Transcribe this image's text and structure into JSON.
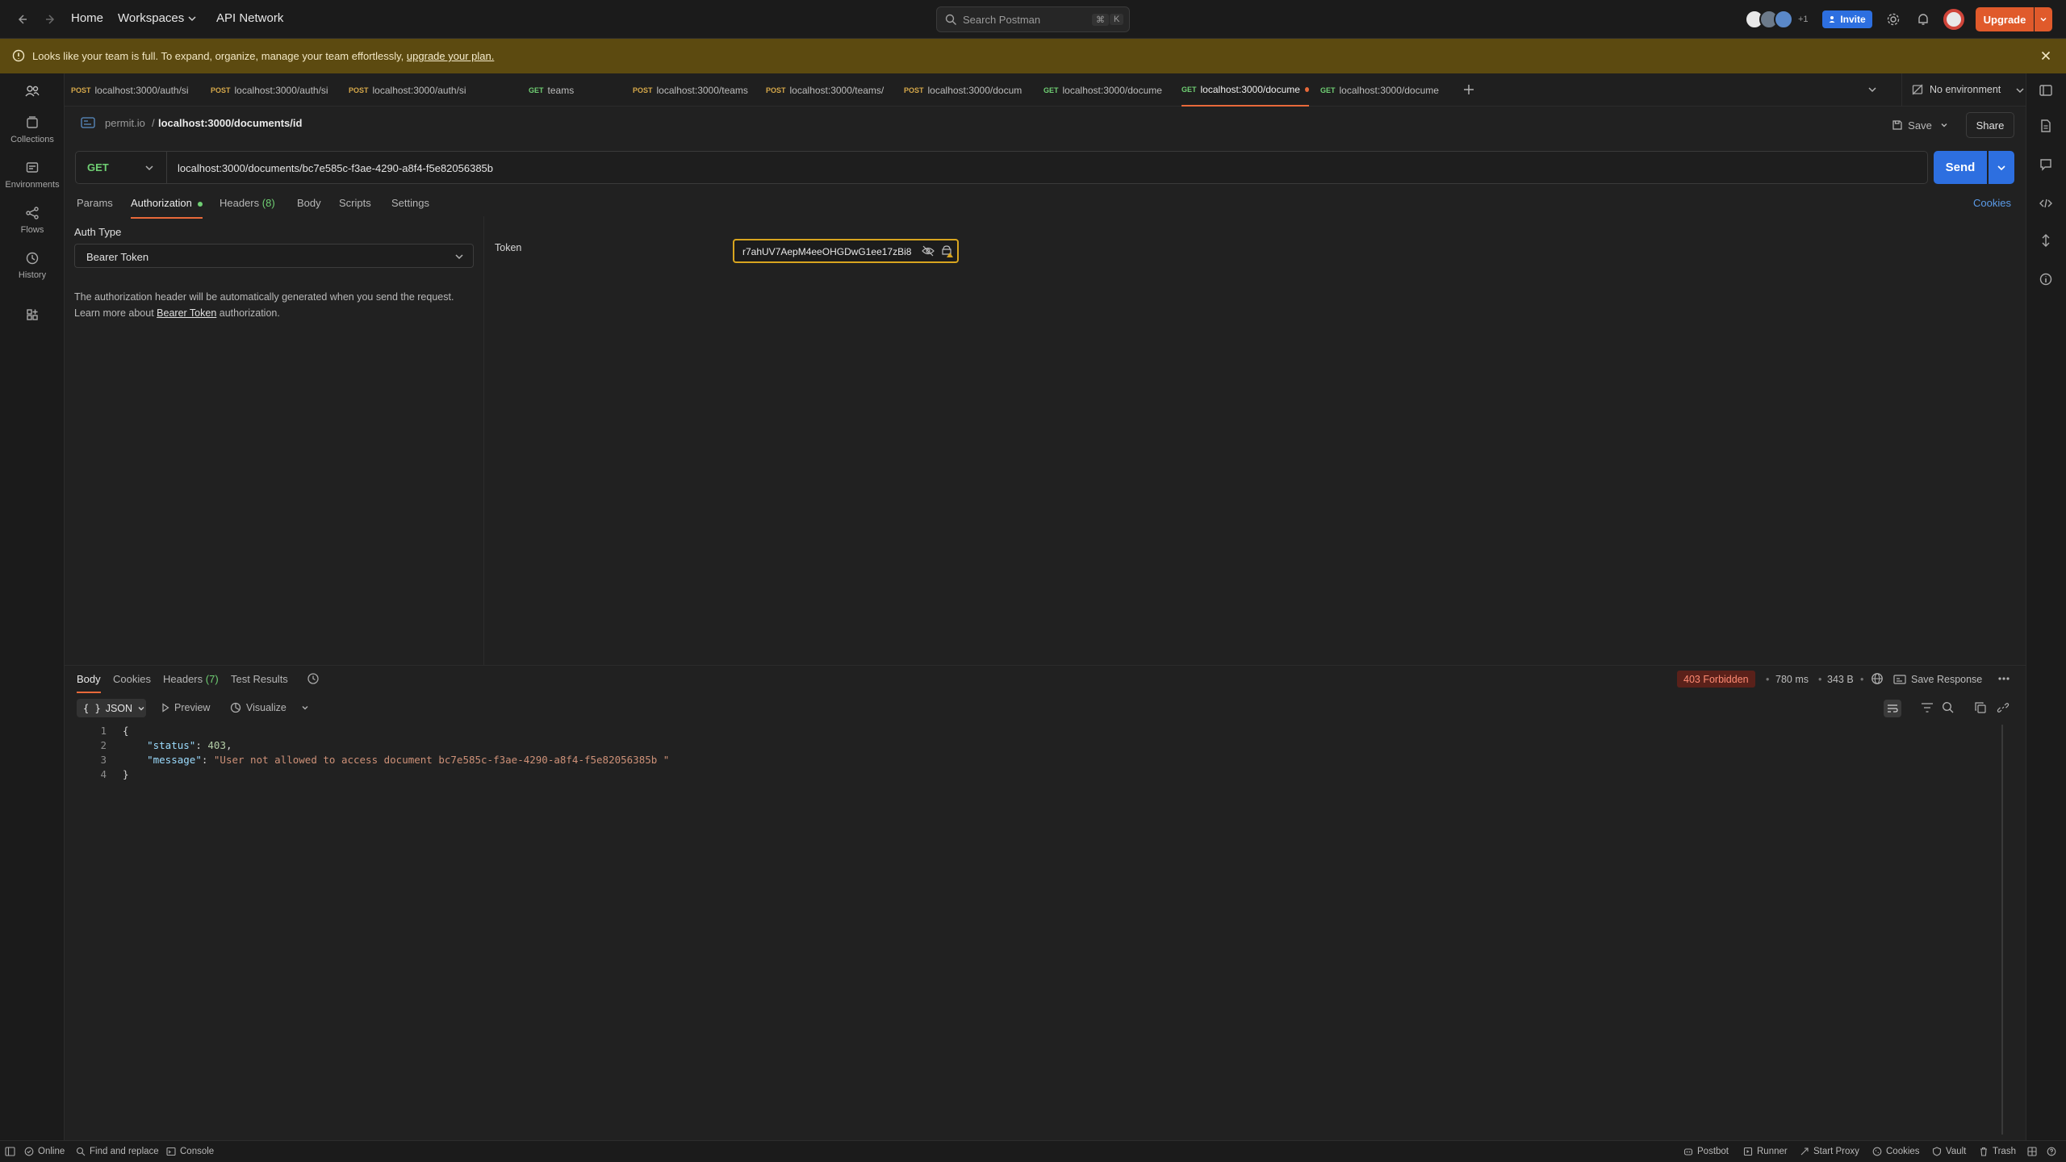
{
  "topbar": {
    "home": "Home",
    "workspaces": "Workspaces",
    "api_network": "API Network",
    "search_placeholder": "Search Postman",
    "search_kbd_1": "⌘",
    "search_kbd_2": "K",
    "avatars_extra": "+1",
    "invite": "Invite",
    "upgrade": "Upgrade"
  },
  "banner": {
    "message": "Looks like your team is full. To expand, organize, manage your team effortlessly,",
    "link": "upgrade your plan."
  },
  "rail": {
    "items": [
      {
        "label": "Collections",
        "icon": "collections-icon"
      },
      {
        "label": "Environments",
        "icon": "environments-icon"
      },
      {
        "label": "Flows",
        "icon": "flows-icon"
      },
      {
        "label": "History",
        "icon": "history-icon"
      }
    ]
  },
  "tabs": [
    {
      "method": "POST",
      "label": "localhost:3000/auth/si"
    },
    {
      "method": "POST",
      "label": "localhost:3000/auth/si"
    },
    {
      "method": "POST",
      "label": "localhost:3000/auth/si"
    },
    {
      "method": "GET",
      "label": "teams"
    },
    {
      "method": "POST",
      "label": "localhost:3000/teams"
    },
    {
      "method": "POST",
      "label": "localhost:3000/teams/"
    },
    {
      "method": "POST",
      "label": "localhost:3000/docum"
    },
    {
      "method": "GET",
      "label": "localhost:3000/docume"
    },
    {
      "method": "GET",
      "label": "localhost:3000/docume",
      "active": true
    },
    {
      "method": "GET",
      "label": "localhost:3000/docume"
    }
  ],
  "environment": "No environment",
  "request": {
    "workspace": "permit.io",
    "separator": "/",
    "name": "localhost:3000/documents/id",
    "save": "Save",
    "share": "Share",
    "method": "GET",
    "url": "localhost:3000/documents/bc7e585c-f3ae-4290-a8f4-f5e82056385b",
    "send": "Send",
    "cookies": "Cookies"
  },
  "subtabs": {
    "params": "Params",
    "authorization": "Authorization",
    "headers": "Headers",
    "headers_count": "(8)",
    "body": "Body",
    "scripts": "Scripts",
    "settings": "Settings"
  },
  "auth": {
    "type_label": "Auth Type",
    "type_value": "Bearer Token",
    "desc_1": "The authorization header will be automatically generated when you send the request.",
    "desc_2_prefix": "Learn more about",
    "desc_2_link": "Bearer Token",
    "desc_2_suffix": "authorization.",
    "token_label": "Token",
    "token_value": "r7ahUV7AepM4eeOHGDwG1ee17zBi8"
  },
  "response": {
    "tabs": {
      "body": "Body",
      "cookies": "Cookies",
      "headers": "Headers",
      "headers_count": "(7)",
      "test_results": "Test Results"
    },
    "status": "403 Forbidden",
    "time": "780 ms",
    "size": "343 B",
    "save_response": "Save Response",
    "format": "JSON",
    "preview": "Preview",
    "visualize": "Visualize",
    "lines": [
      "1",
      "2",
      "3",
      "4"
    ],
    "body": {
      "open": "{",
      "status_key": "\"status\"",
      "status_val": "403",
      "message_key": "\"message\"",
      "message_val": "\"User not allowed to access document bc7e585c-f3ae-4290-a8f4-f5e82056385b \"",
      "close": "}"
    }
  },
  "statusbar": {
    "online": "Online",
    "find_replace": "Find and replace",
    "console": "Console",
    "postbot": "Postbot",
    "runner": "Runner",
    "start_proxy": "Start Proxy",
    "cookies": "Cookies",
    "vault": "Vault",
    "trash": "Trash"
  },
  "colors": {
    "accent": "#e8693a",
    "send_blue": "#2d6fe0",
    "get_green": "#6fcf73",
    "post_yellow": "#d6a84a",
    "error_bg": "#5a211a",
    "banner_bg": "#5c4a10"
  }
}
